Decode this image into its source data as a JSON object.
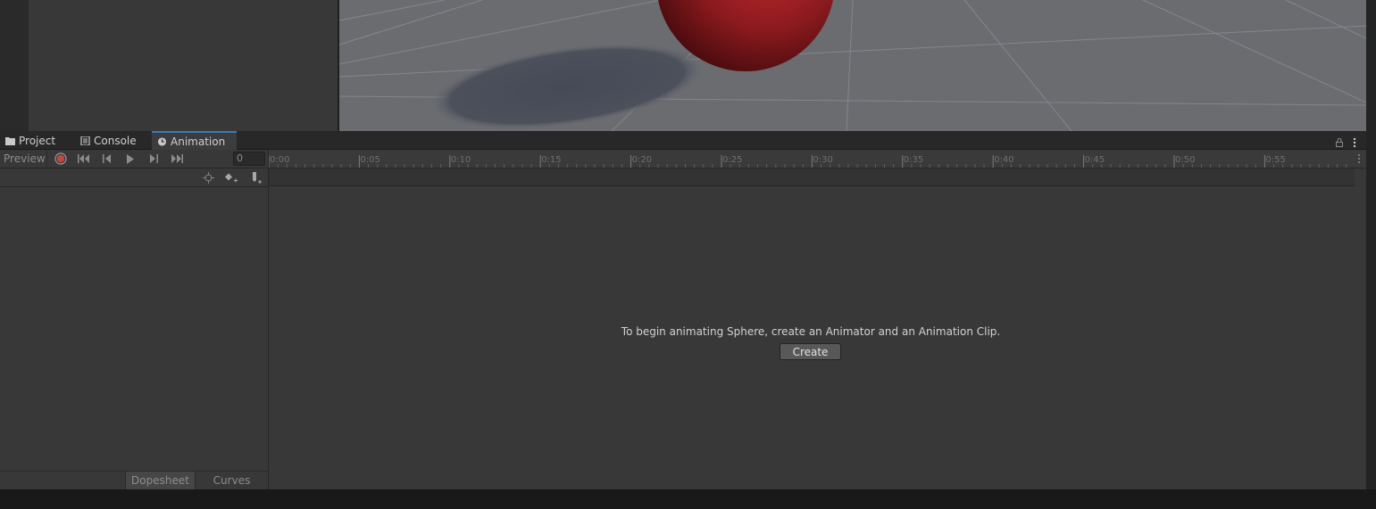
{
  "tabs": [
    {
      "label": "Project",
      "icon": "folder-icon"
    },
    {
      "label": "Console",
      "icon": "console-icon"
    },
    {
      "label": "Animation",
      "icon": "clock-icon",
      "active": true
    }
  ],
  "toolbar": {
    "preview_label": "Preview",
    "frame_value": "0"
  },
  "timeline": {
    "labels": [
      "0:00",
      "0:05",
      "0:10",
      "0:15",
      "0:20",
      "0:25",
      "0:30",
      "0:35",
      "0:40",
      "0:45",
      "0:50",
      "0:55"
    ]
  },
  "message": {
    "text": "To begin animating Sphere, create an Animator and an Animation Clip.",
    "create_label": "Create"
  },
  "modes": {
    "dopesheet_label": "Dopesheet",
    "curves_label": "Curves"
  },
  "colors": {
    "accent": "#3a79bb",
    "record_red": "#c2493a",
    "sphere_red": "#8a1a1e"
  }
}
